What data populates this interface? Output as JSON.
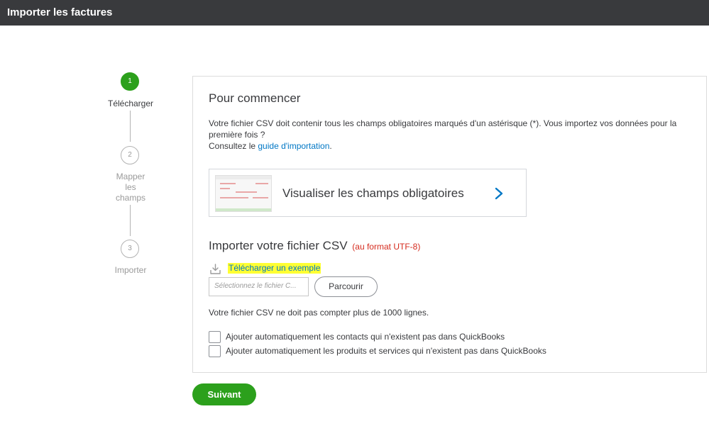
{
  "header": {
    "title": "Importer les factures"
  },
  "stepper": {
    "steps": [
      {
        "number": "1",
        "label": "Télécharger",
        "active": true
      },
      {
        "number": "2",
        "label": "Mapper les champs",
        "label_lines": [
          "Mapper",
          "les",
          "champs"
        ],
        "active": false
      },
      {
        "number": "3",
        "label": "Importer",
        "active": false
      }
    ]
  },
  "getting_started": {
    "title": "Pour commencer",
    "description_line1": "Votre fichier CSV doit contenir tous les champs obligatoires marqués d'un astérisque (*). Vous importez vos données pour la première fois ?",
    "description_line2_prefix": "Consultez le ",
    "guide_link": "guide d'importation",
    "description_line2_suffix": "."
  },
  "preview_card": {
    "label": "Visualiser les champs obligatoires",
    "icon": "chevron-right-icon"
  },
  "import_section": {
    "title": "Importer votre fichier CSV",
    "format_note": "(au format UTF-8)",
    "download_icon": "download-icon",
    "download_link": "Télécharger un exemple",
    "file_placeholder": "Sélectionnez le fichier C...",
    "browse_label": "Parcourir",
    "limit_note": "Votre fichier CSV ne doit pas compter plus de 1000 lignes."
  },
  "options": {
    "add_contacts_label": "Ajouter automatiquement les contacts qui n'existent pas dans QuickBooks",
    "add_products_label": "Ajouter automatiquement les produits et services qui n'existent pas dans QuickBooks"
  },
  "footer": {
    "next_label": "Suivant"
  },
  "colors": {
    "accent": "#2ca01c",
    "header_bg": "#393a3d",
    "link": "#0077c5",
    "warning": "#d52b1e",
    "highlight": "#ffff33"
  }
}
